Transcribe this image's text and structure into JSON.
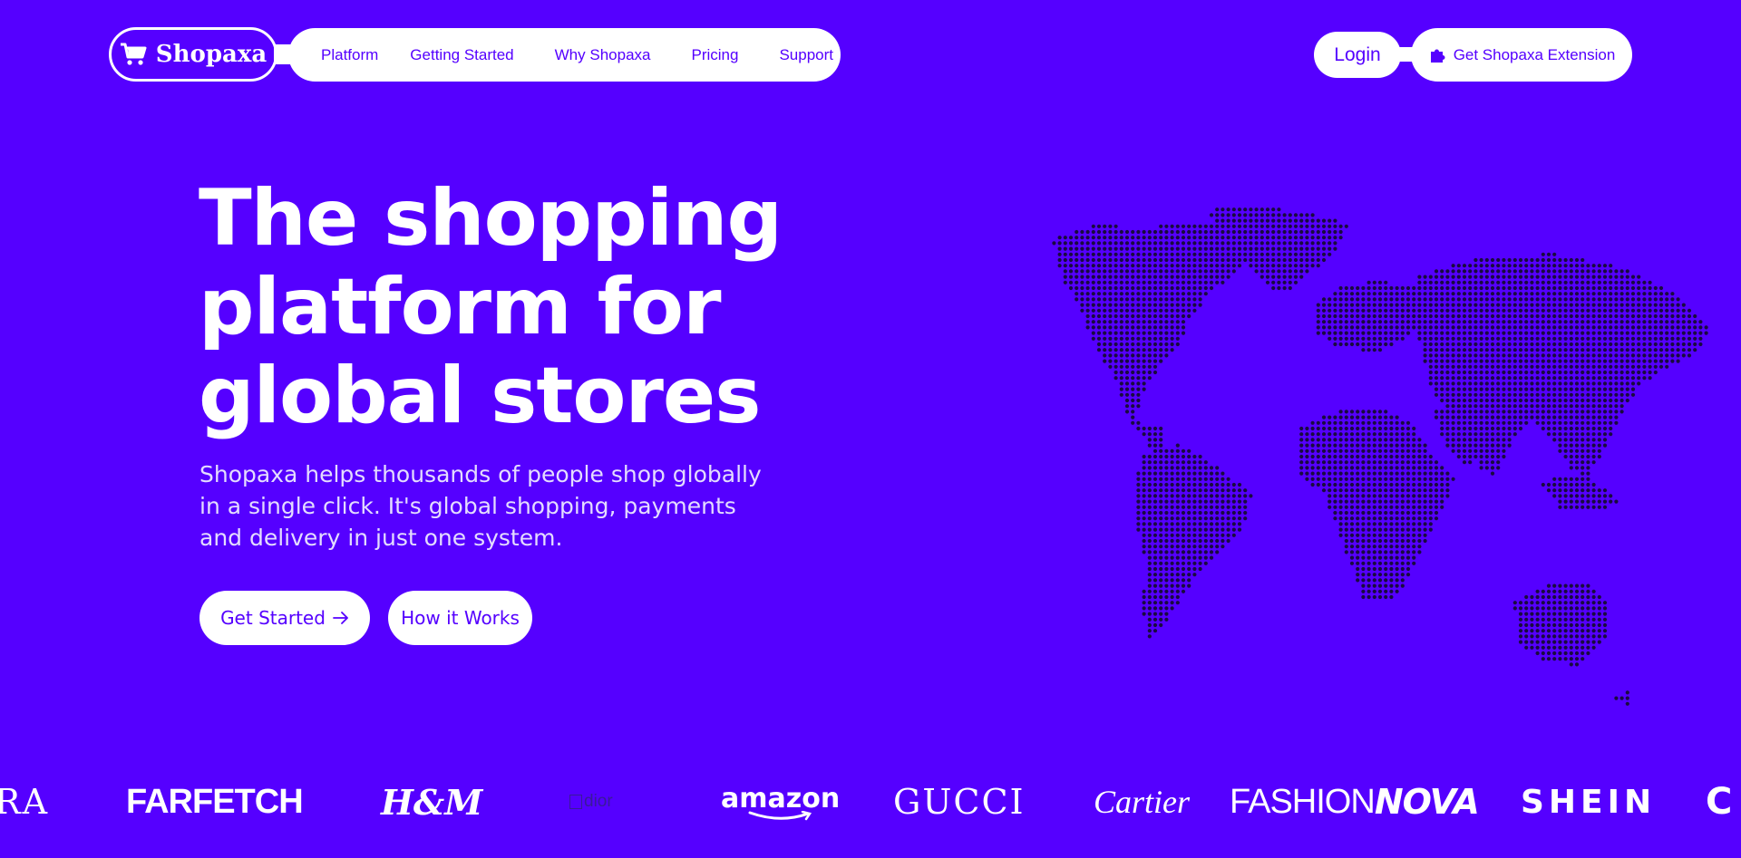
{
  "brand": {
    "name": "Shopaxa",
    "icon": "cart-icon"
  },
  "nav": {
    "items": [
      {
        "label": "Platform"
      },
      {
        "label": "Getting Started"
      },
      {
        "label": "Why Shopaxa"
      },
      {
        "label": "Pricing"
      },
      {
        "label": "Support"
      }
    ],
    "login_label": "Login",
    "extension_label": "Get Shopaxa Extension",
    "extension_icon": "puzzle-icon"
  },
  "hero": {
    "headline_lines": [
      "The shopping",
      "platform for",
      "global stores"
    ],
    "subtext_lines": [
      "Shopaxa helps thousands of people shop globally",
      "in a single click. It's global shopping, payments",
      "and delivery in just one system."
    ],
    "cta_primary": "Get Started",
    "cta_secondary": "How it Works",
    "map_icon": "world-map-dots"
  },
  "brands": {
    "partial_left": "RA",
    "farfetch": "FARFETCH",
    "hm": "H&M",
    "dior_alt": "dior",
    "amazon": "amazon",
    "gucci": "GUCCI",
    "cartier": "Cartier",
    "fashion": "FASHION",
    "nova": "NOVA",
    "shein": "SHEIN",
    "partial_right": "C"
  },
  "colors": {
    "background": "#5500ff",
    "pill": "#ffffff",
    "accent": "#5500ff",
    "map_dots": "#1a0a40"
  }
}
